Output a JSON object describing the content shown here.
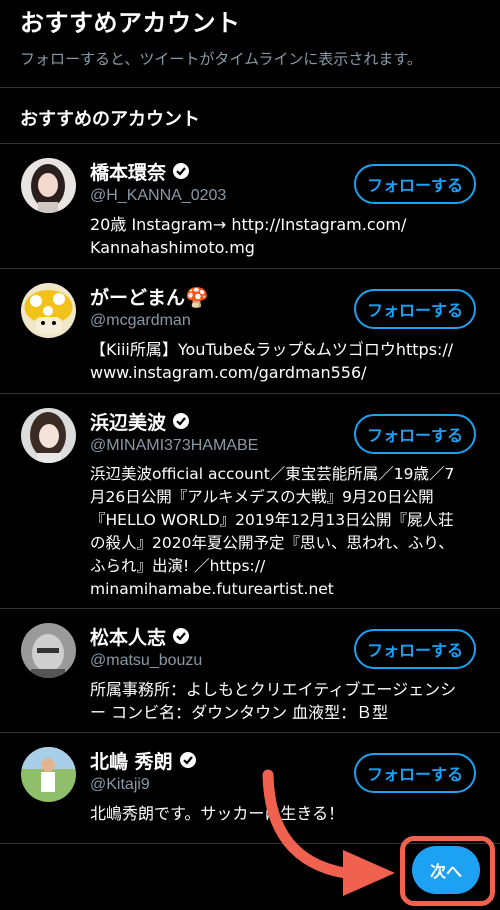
{
  "header": {
    "title": "おすすめアカウント",
    "subtitle": "フォローすると、ツイートがタイムラインに表示されます。"
  },
  "section_title": "おすすめのアカウント",
  "follow_label": "フォローする",
  "next_label": "次へ",
  "colors": {
    "accent": "#1da1f2",
    "highlight": "#f0614f",
    "background": "#000000"
  },
  "accounts": [
    {
      "name": "橋本環奈",
      "verified": true,
      "handle": "@H_KANNA_0203",
      "bio": [
        "20歳 Instagram→ http://Instagram.com/",
        "Kannahashimoto.mg"
      ]
    },
    {
      "name": "がーどまん🍄",
      "verified": false,
      "handle": "@mcgardman",
      "bio": [
        "【Kiii所属】YouTube&ラップ&ムツゴロウhttps://",
        "www.instagram.com/gardman556/"
      ]
    },
    {
      "name": "浜辺美波",
      "verified": true,
      "handle": "@MINAMI373HAMABE",
      "bio": [
        "浜辺美波official account／東宝芸能所属／19歳／7",
        "月26日公開『アルキメデスの大戦』9月20日公開",
        "『HELLO WORLD』2019年12月13日公開『屍人荘",
        "の殺人』2020年夏公開予定『思い、思われ、ふり、",
        "ふられ』出演! ／https://",
        "minamihamabe.futureartist.net"
      ]
    },
    {
      "name": "松本人志",
      "verified": true,
      "handle": "@matsu_bouzu",
      "bio": [
        "所属事務所：よしもとクリエイティブエージェンシ",
        "ー コンビ名：ダウンタウン 血液型：Ｂ型"
      ]
    },
    {
      "name": "北嶋 秀朗",
      "verified": true,
      "handle": "@Kitaji9",
      "bio": [
        "北嶋秀朗です。サッカーに生きる！"
      ]
    }
  ]
}
